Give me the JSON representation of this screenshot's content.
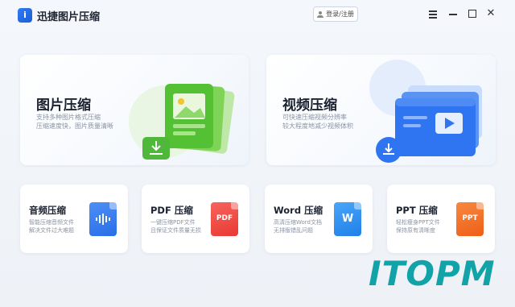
{
  "app": {
    "title": "迅捷图片压缩",
    "logo_text": "i",
    "login_label": "登录/注册"
  },
  "cards": {
    "image": {
      "title": "图片压缩",
      "desc1": "支持多种图片格式压缩",
      "desc2": "压缩速度快，图片质量清晰"
    },
    "video": {
      "title": "视频压缩",
      "desc1": "可快速压缩视频分辨率",
      "desc2": "较大程度地减少视频体积"
    },
    "audio": {
      "title": "音频压缩",
      "desc1": "智能压缩音频文件",
      "desc2": "解决文件过大难题"
    },
    "pdf": {
      "title": "PDF 压缩",
      "desc1": "一键压缩PDF文件",
      "desc2": "且保证文件质量无损",
      "icon_label": "PDF"
    },
    "word": {
      "title": "Word 压缩",
      "desc1": "高清压缩Word文档",
      "desc2": "无排版错乱问题",
      "icon_label": "W"
    },
    "ppt": {
      "title": "PPT 压缩",
      "desc1": "轻松瘦身PPT文件",
      "desc2": "保持原有清晰度",
      "icon_label": "PPT"
    }
  },
  "watermark": {
    "text": "ITOPM"
  },
  "colors": {
    "image_accent": "#5cc53f",
    "video_accent": "#2f74f0",
    "audio_icon": "#2f74f0",
    "pdf_icon": "#f2453d",
    "word_icon": "#2b8ff0",
    "ppt_icon": "#f2691f",
    "watermark": "#11a3a8"
  },
  "icons": [
    "app-logo-icon",
    "user-icon",
    "menu-icon",
    "minimize-icon",
    "maximize-icon",
    "close-icon",
    "image-illustration",
    "video-illustration",
    "audio-file-icon",
    "pdf-file-icon",
    "word-file-icon",
    "ppt-file-icon"
  ]
}
